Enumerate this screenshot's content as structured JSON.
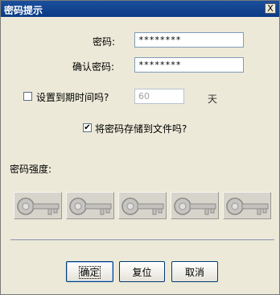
{
  "window": {
    "title": "密码提示",
    "close_glyph": "X"
  },
  "form": {
    "password_label": "密码:",
    "password_value": "********",
    "confirm_label": "确认密码:",
    "confirm_value": "********",
    "expire_checkbox_label": "设置到期时间吗?",
    "expire_checked": false,
    "expire_days_value": "60",
    "days_unit": "天",
    "save_checkbox_label": "将密码存储到文件吗?",
    "save_checked": true,
    "save_check_glyph": "✔",
    "strength_label": "密码强度:",
    "strength_keys": [
      "key-icon",
      "key-icon",
      "key-icon",
      "key-icon",
      "key-icon"
    ]
  },
  "buttons": {
    "ok_label": "确定",
    "reset_label": "复位",
    "cancel_label": "取消"
  }
}
